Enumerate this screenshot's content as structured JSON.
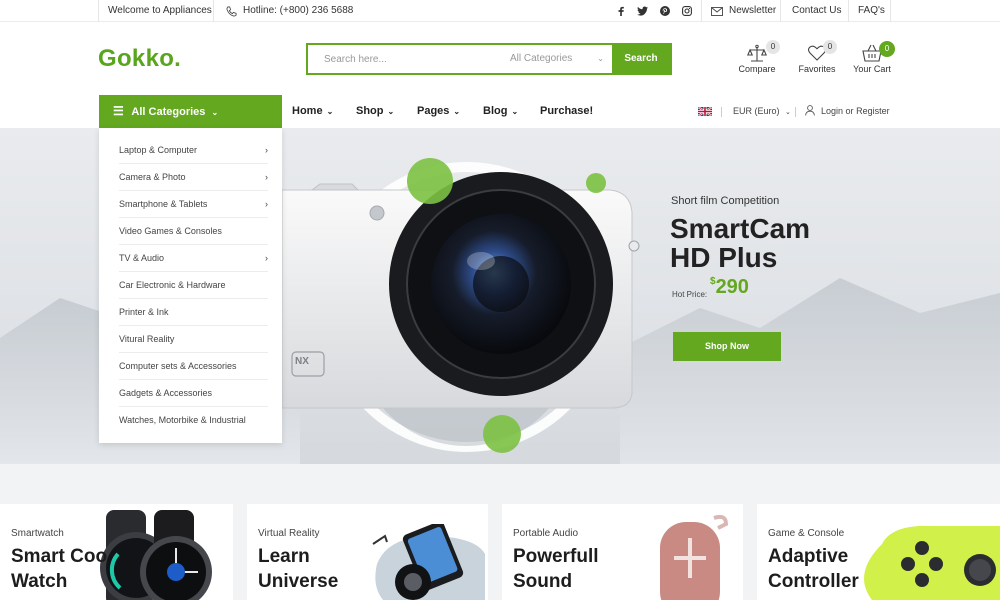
{
  "topbar": {
    "welcome": "Welcome to Appliances",
    "hotline": "Hotline: (+800) 236 5688",
    "newsletter": "Newsletter",
    "contact": "Contact Us",
    "faq": "FAQ's"
  },
  "header": {
    "logo": "Gokko.",
    "search_placeholder": "Search here...",
    "search_category": "All Categories",
    "search_button": "Search",
    "compare_label": "Compare",
    "compare_count": "0",
    "favorites_label": "Favorites",
    "favorites_count": "0",
    "cart_label": "Your Cart",
    "cart_count": "0"
  },
  "nav": {
    "all_categories": "All Categories",
    "items": [
      "Home",
      "Shop",
      "Pages",
      "Blog",
      "Purchase!"
    ],
    "currency": "EUR (Euro)",
    "login": "Login",
    "or": "or",
    "register": "Register"
  },
  "categories": [
    {
      "label": "Laptop & Computer",
      "has_sub": true
    },
    {
      "label": "Camera & Photo",
      "has_sub": true
    },
    {
      "label": "Smartphone & Tablets",
      "has_sub": true
    },
    {
      "label": "Video Games & Consoles",
      "has_sub": false
    },
    {
      "label": "TV & Audio",
      "has_sub": true
    },
    {
      "label": "Car Electronic & Hardware",
      "has_sub": false
    },
    {
      "label": "Printer & Ink",
      "has_sub": false
    },
    {
      "label": "Vitural Reality",
      "has_sub": false
    },
    {
      "label": "Computer sets & Accessories",
      "has_sub": false
    },
    {
      "label": "Gadgets & Accessories",
      "has_sub": false
    },
    {
      "label": "Watches, Motorbike & Industrial",
      "has_sub": false
    }
  ],
  "hero": {
    "subtitle": "Short film Competition",
    "title_line1": "SmartCam",
    "title_line2": "HD Plus",
    "price_label": "Hot Price:",
    "currency": "$",
    "price": "290",
    "button": "Shop Now",
    "camera_badge": "NX"
  },
  "cards": [
    {
      "sub": "Smartwatch",
      "line1": "Smart Coo",
      "line2": "Watch"
    },
    {
      "sub": "Virtual Reality",
      "line1": "Learn",
      "line2": "Universe"
    },
    {
      "sub": "Portable Audio",
      "line1": "Powerfull",
      "line2": "Sound"
    },
    {
      "sub": "Game & Console",
      "line1": "Adaptive",
      "line2": "Controller"
    }
  ],
  "colors": {
    "accent": "#63a81f"
  }
}
